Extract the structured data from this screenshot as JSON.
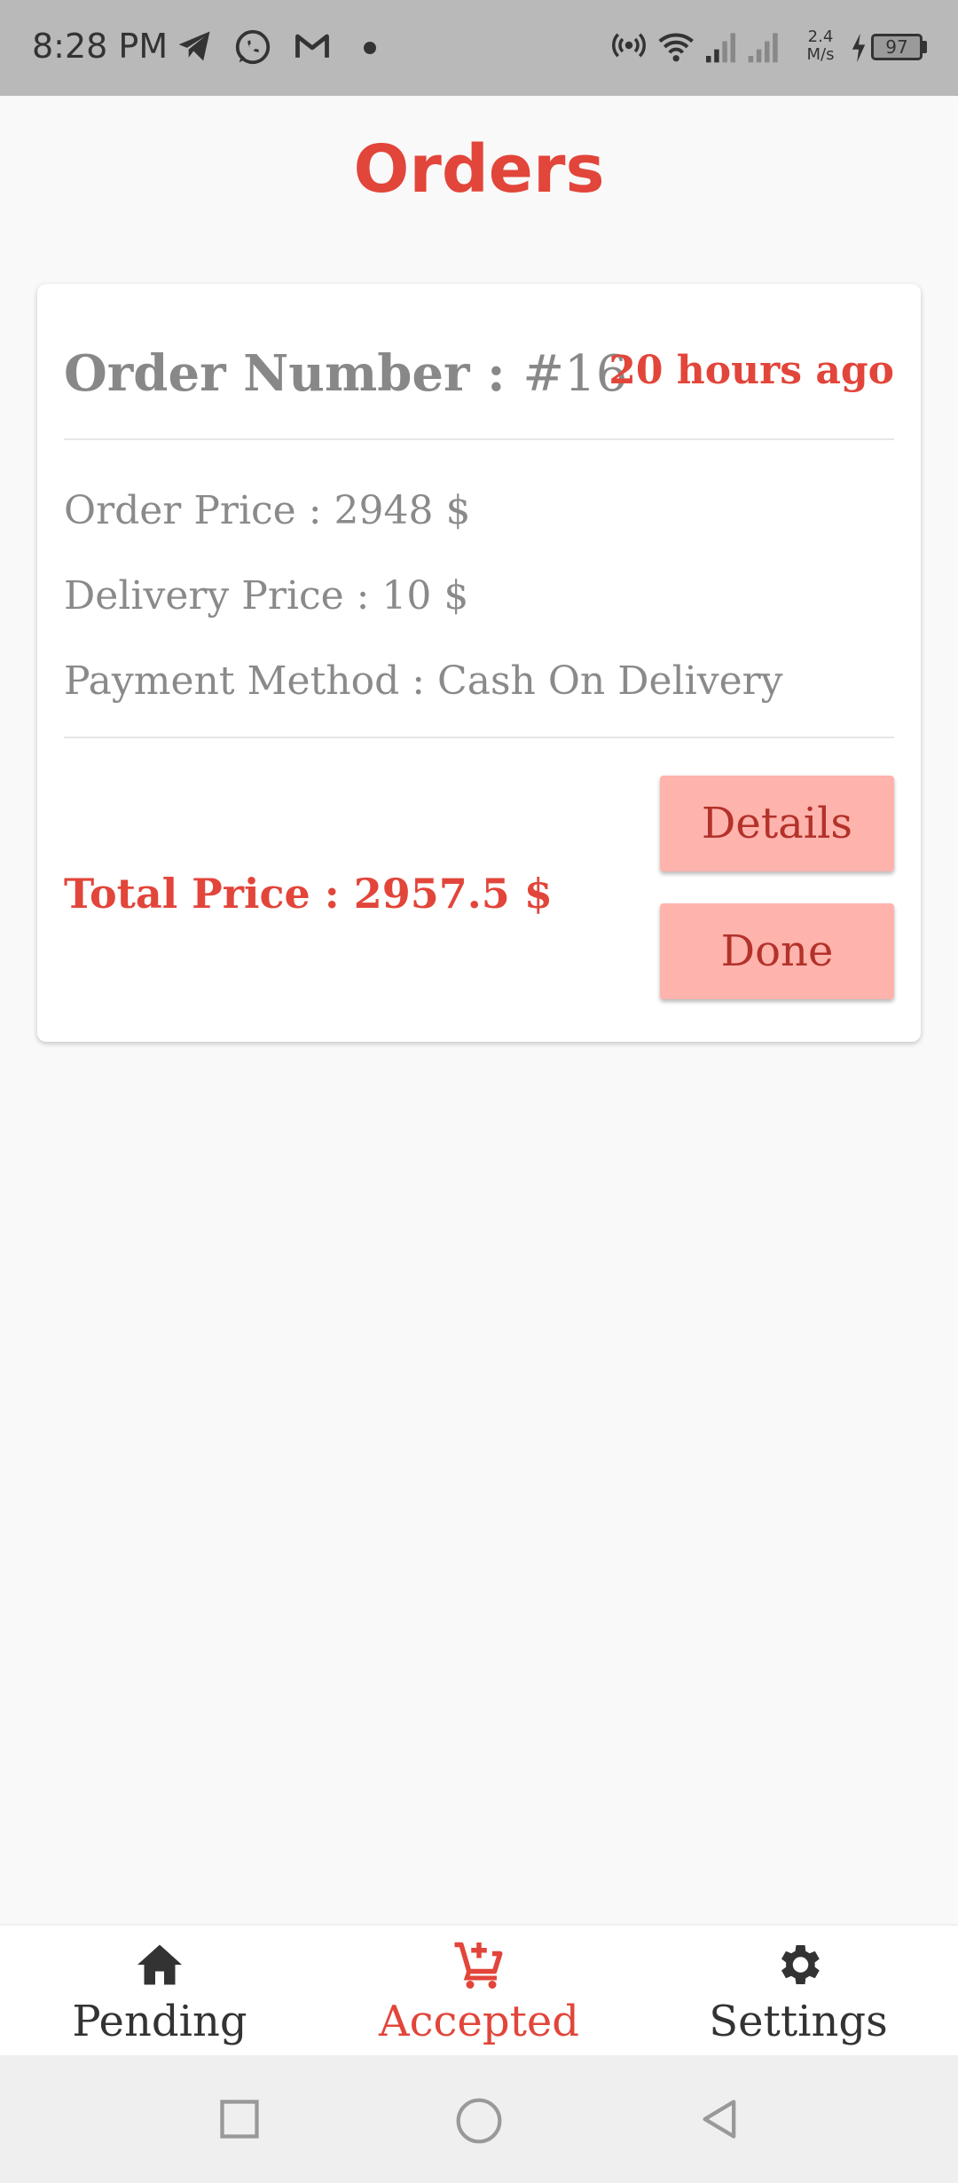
{
  "status_bar": {
    "time": "8:28 PM",
    "net_speed_value": "2.4",
    "net_speed_unit": "M/s",
    "battery": "97",
    "icons": [
      "telegram-icon",
      "whatsapp-icon",
      "gmail-icon",
      "hotspot-icon",
      "wifi-icon",
      "signal-icon",
      "charging-icon",
      "battery-icon"
    ]
  },
  "header": {
    "title": "Orders"
  },
  "order": {
    "number_label": "Order Number : ",
    "number_value": "#16",
    "time_ago": "20 hours ago",
    "order_price": "Order Price : 2948 $",
    "delivery_price": "Delivery Price : 10 $",
    "payment_method": "Payment Method : Cash On Delivery",
    "total_price": "Total Price : 2957.5 $",
    "details_button": "Details",
    "done_button": "Done"
  },
  "bottom_nav": {
    "items": [
      {
        "label": "Pending",
        "icon": "home-icon"
      },
      {
        "label": "Accepted",
        "icon": "cart-add-icon",
        "active": true
      },
      {
        "label": "Settings",
        "icon": "gear-icon"
      }
    ]
  },
  "system_nav": {
    "icons": [
      "recents-icon",
      "home-circle-icon",
      "back-icon"
    ]
  },
  "colors": {
    "accent": "#e2453a",
    "button_bg": "#ffb3ad",
    "muted_text": "#888888",
    "status_bar_bg": "#b9b9b9"
  }
}
